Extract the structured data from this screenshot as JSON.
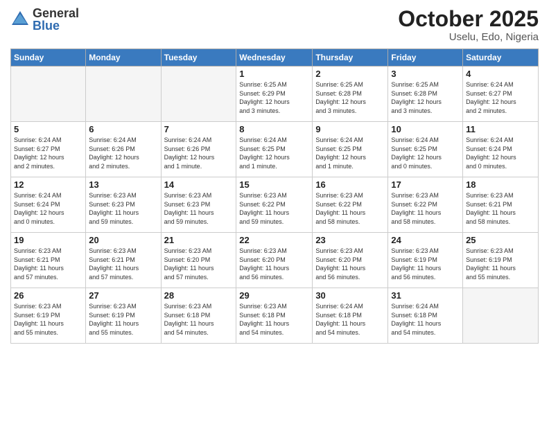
{
  "header": {
    "logo_general": "General",
    "logo_blue": "Blue",
    "title": "October 2025",
    "subtitle": "Uselu, Edo, Nigeria"
  },
  "days_of_week": [
    "Sunday",
    "Monday",
    "Tuesday",
    "Wednesday",
    "Thursday",
    "Friday",
    "Saturday"
  ],
  "weeks": [
    [
      {
        "day": "",
        "info": ""
      },
      {
        "day": "",
        "info": ""
      },
      {
        "day": "",
        "info": ""
      },
      {
        "day": "1",
        "info": "Sunrise: 6:25 AM\nSunset: 6:29 PM\nDaylight: 12 hours\nand 3 minutes."
      },
      {
        "day": "2",
        "info": "Sunrise: 6:25 AM\nSunset: 6:28 PM\nDaylight: 12 hours\nand 3 minutes."
      },
      {
        "day": "3",
        "info": "Sunrise: 6:25 AM\nSunset: 6:28 PM\nDaylight: 12 hours\nand 3 minutes."
      },
      {
        "day": "4",
        "info": "Sunrise: 6:24 AM\nSunset: 6:27 PM\nDaylight: 12 hours\nand 2 minutes."
      }
    ],
    [
      {
        "day": "5",
        "info": "Sunrise: 6:24 AM\nSunset: 6:27 PM\nDaylight: 12 hours\nand 2 minutes."
      },
      {
        "day": "6",
        "info": "Sunrise: 6:24 AM\nSunset: 6:26 PM\nDaylight: 12 hours\nand 2 minutes."
      },
      {
        "day": "7",
        "info": "Sunrise: 6:24 AM\nSunset: 6:26 PM\nDaylight: 12 hours\nand 1 minute."
      },
      {
        "day": "8",
        "info": "Sunrise: 6:24 AM\nSunset: 6:25 PM\nDaylight: 12 hours\nand 1 minute."
      },
      {
        "day": "9",
        "info": "Sunrise: 6:24 AM\nSunset: 6:25 PM\nDaylight: 12 hours\nand 1 minute."
      },
      {
        "day": "10",
        "info": "Sunrise: 6:24 AM\nSunset: 6:25 PM\nDaylight: 12 hours\nand 0 minutes."
      },
      {
        "day": "11",
        "info": "Sunrise: 6:24 AM\nSunset: 6:24 PM\nDaylight: 12 hours\nand 0 minutes."
      }
    ],
    [
      {
        "day": "12",
        "info": "Sunrise: 6:24 AM\nSunset: 6:24 PM\nDaylight: 12 hours\nand 0 minutes."
      },
      {
        "day": "13",
        "info": "Sunrise: 6:23 AM\nSunset: 6:23 PM\nDaylight: 11 hours\nand 59 minutes."
      },
      {
        "day": "14",
        "info": "Sunrise: 6:23 AM\nSunset: 6:23 PM\nDaylight: 11 hours\nand 59 minutes."
      },
      {
        "day": "15",
        "info": "Sunrise: 6:23 AM\nSunset: 6:22 PM\nDaylight: 11 hours\nand 59 minutes."
      },
      {
        "day": "16",
        "info": "Sunrise: 6:23 AM\nSunset: 6:22 PM\nDaylight: 11 hours\nand 58 minutes."
      },
      {
        "day": "17",
        "info": "Sunrise: 6:23 AM\nSunset: 6:22 PM\nDaylight: 11 hours\nand 58 minutes."
      },
      {
        "day": "18",
        "info": "Sunrise: 6:23 AM\nSunset: 6:21 PM\nDaylight: 11 hours\nand 58 minutes."
      }
    ],
    [
      {
        "day": "19",
        "info": "Sunrise: 6:23 AM\nSunset: 6:21 PM\nDaylight: 11 hours\nand 57 minutes."
      },
      {
        "day": "20",
        "info": "Sunrise: 6:23 AM\nSunset: 6:21 PM\nDaylight: 11 hours\nand 57 minutes."
      },
      {
        "day": "21",
        "info": "Sunrise: 6:23 AM\nSunset: 6:20 PM\nDaylight: 11 hours\nand 57 minutes."
      },
      {
        "day": "22",
        "info": "Sunrise: 6:23 AM\nSunset: 6:20 PM\nDaylight: 11 hours\nand 56 minutes."
      },
      {
        "day": "23",
        "info": "Sunrise: 6:23 AM\nSunset: 6:20 PM\nDaylight: 11 hours\nand 56 minutes."
      },
      {
        "day": "24",
        "info": "Sunrise: 6:23 AM\nSunset: 6:19 PM\nDaylight: 11 hours\nand 56 minutes."
      },
      {
        "day": "25",
        "info": "Sunrise: 6:23 AM\nSunset: 6:19 PM\nDaylight: 11 hours\nand 55 minutes."
      }
    ],
    [
      {
        "day": "26",
        "info": "Sunrise: 6:23 AM\nSunset: 6:19 PM\nDaylight: 11 hours\nand 55 minutes."
      },
      {
        "day": "27",
        "info": "Sunrise: 6:23 AM\nSunset: 6:19 PM\nDaylight: 11 hours\nand 55 minutes."
      },
      {
        "day": "28",
        "info": "Sunrise: 6:23 AM\nSunset: 6:18 PM\nDaylight: 11 hours\nand 54 minutes."
      },
      {
        "day": "29",
        "info": "Sunrise: 6:23 AM\nSunset: 6:18 PM\nDaylight: 11 hours\nand 54 minutes."
      },
      {
        "day": "30",
        "info": "Sunrise: 6:24 AM\nSunset: 6:18 PM\nDaylight: 11 hours\nand 54 minutes."
      },
      {
        "day": "31",
        "info": "Sunrise: 6:24 AM\nSunset: 6:18 PM\nDaylight: 11 hours\nand 54 minutes."
      },
      {
        "day": "",
        "info": ""
      }
    ]
  ]
}
